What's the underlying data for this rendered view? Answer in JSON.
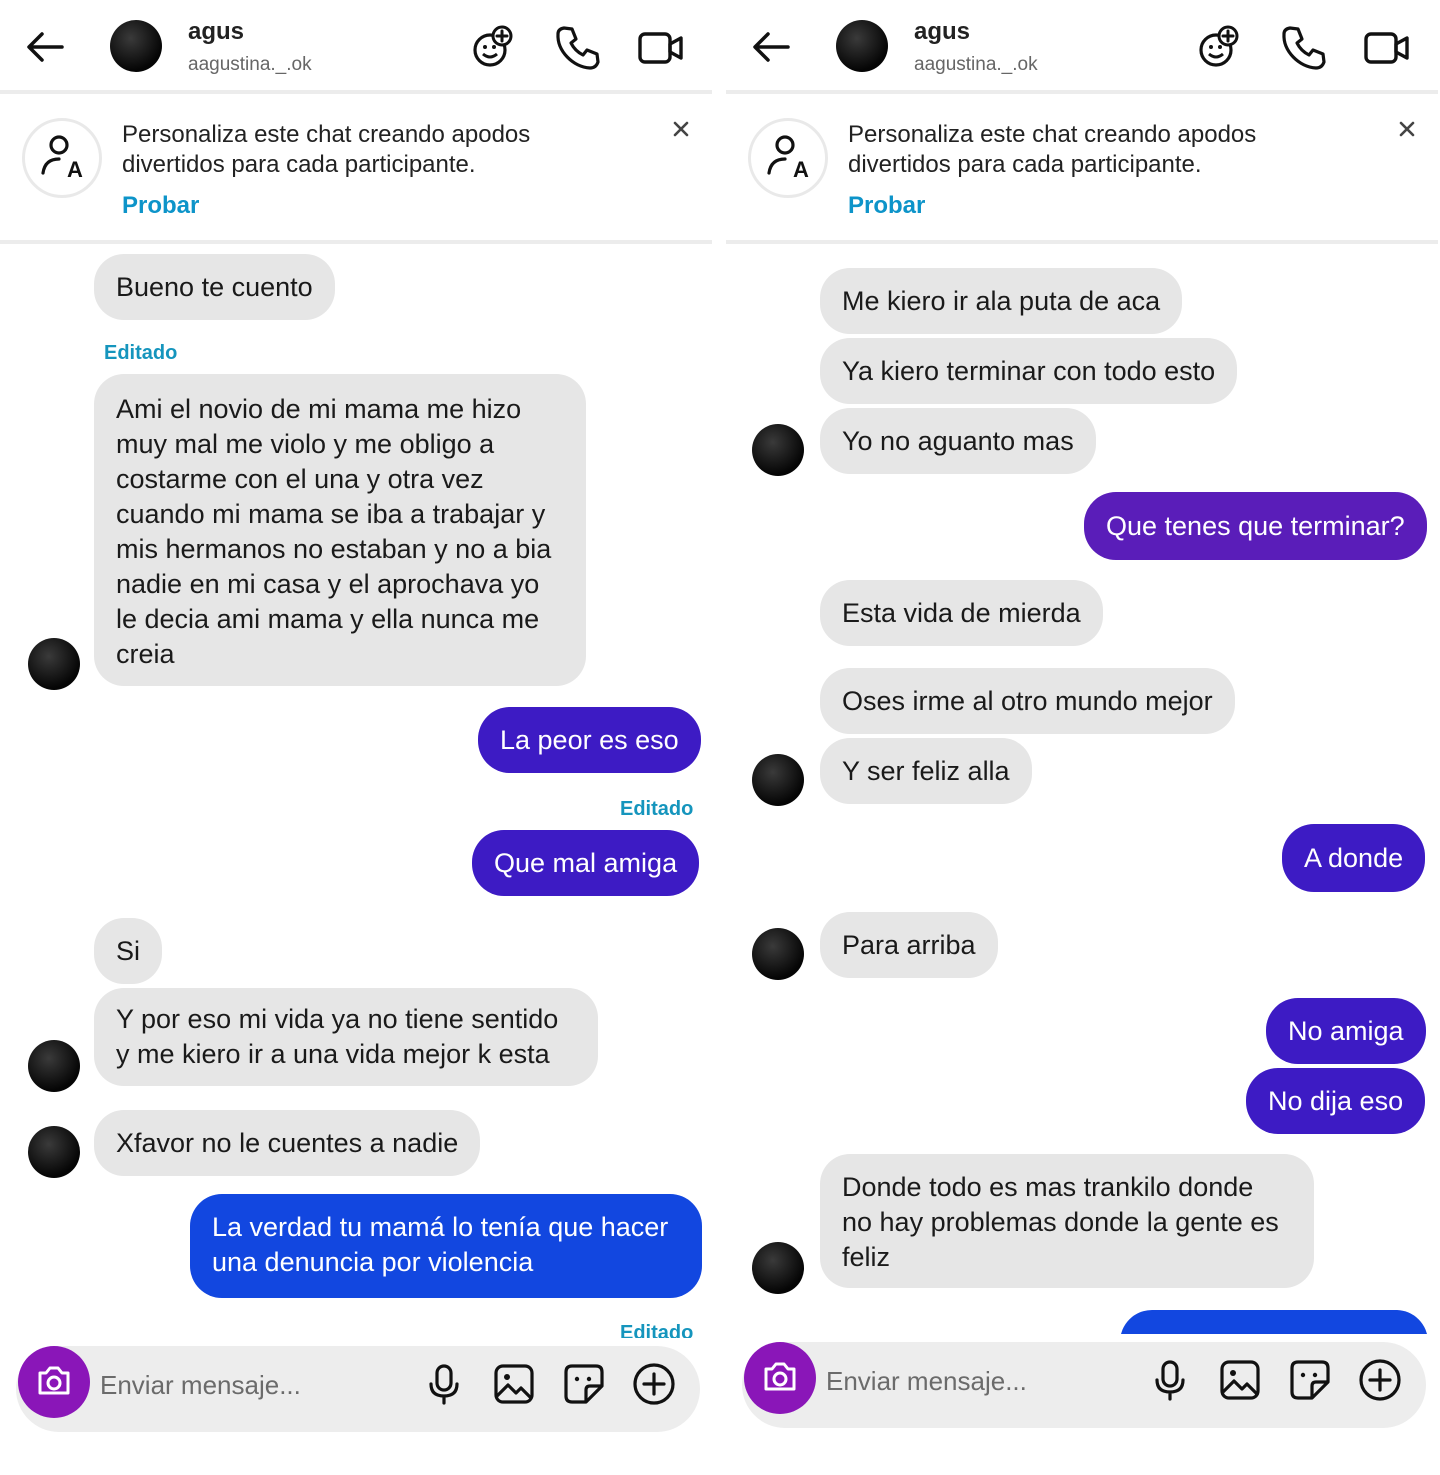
{
  "left": {
    "header": {
      "name": "agus",
      "username": "aagustina._.ok"
    },
    "banner": {
      "text": "Personaliza este chat creando apodos divertidos para cada participante.",
      "cta": "Probar"
    },
    "compose": {
      "placeholder": "Enviar mensaje..."
    },
    "tags": [
      "Editado",
      "Editado",
      "Editado"
    ],
    "messages": [
      {
        "text": "Bueno te cuento"
      },
      {
        "text": "Ami el novio de mi mama me hizo\nmuy mal me violo y me obligo a\ncostarme con el una y otra vez\ncuando mi mama se iba a trabajar y\nmis hermanos no estaban y no a bia\nnadie en mi casa y el aprochava yo\nle decia ami mama y ella nunca me\ncreia"
      },
      {
        "text": "La peor es eso"
      },
      {
        "text": "Que mal amiga"
      },
      {
        "text": "Si"
      },
      {
        "text": "Y por eso mi vida ya no tiene sentido\ny me kiero ir a una vida mejor k esta"
      },
      {
        "text": "Xfavor no le cuentes a nadie"
      },
      {
        "text": "La verdad tu mamá lo tenía que hacer\nuna denuncia por violencia"
      }
    ]
  },
  "right": {
    "header": {
      "name": "agus",
      "username": "aagustina._.ok"
    },
    "banner": {
      "text": "Personaliza este chat creando apodos divertidos para cada participante.",
      "cta": "Probar"
    },
    "compose": {
      "placeholder": "Enviar mensaje..."
    },
    "messages": [
      {
        "text": "Me kiero ir ala puta de aca"
      },
      {
        "text": "Ya kiero terminar con todo esto"
      },
      {
        "text": "Yo no aguanto mas"
      },
      {
        "text": "Que tenes que terminar?"
      },
      {
        "text": "Esta vida de mierda"
      },
      {
        "text": "Oses irme al otro mundo mejor"
      },
      {
        "text": "Y ser feliz alla"
      },
      {
        "text": "A donde"
      },
      {
        "text": "Para arriba"
      },
      {
        "text": "No amiga"
      },
      {
        "text": "No dija eso"
      },
      {
        "text": "Donde todo es mas trankilo donde\nno hay problemas donde la gente es\nfeliz"
      }
    ]
  },
  "colors": {
    "purple": "#5a1db9",
    "indigo": "#3d1bc4",
    "blue": "#1247e0",
    "incoming": "#e6e6e6",
    "link": "#0d94c9",
    "camera": "#8a16b8"
  },
  "icons": [
    "back-arrow-icon",
    "avatar-icon",
    "effects-icon",
    "phone-icon",
    "video-icon",
    "nickname-icon",
    "close-icon",
    "camera-icon",
    "microphone-icon",
    "gallery-icon",
    "sticker-icon",
    "plus-icon"
  ]
}
